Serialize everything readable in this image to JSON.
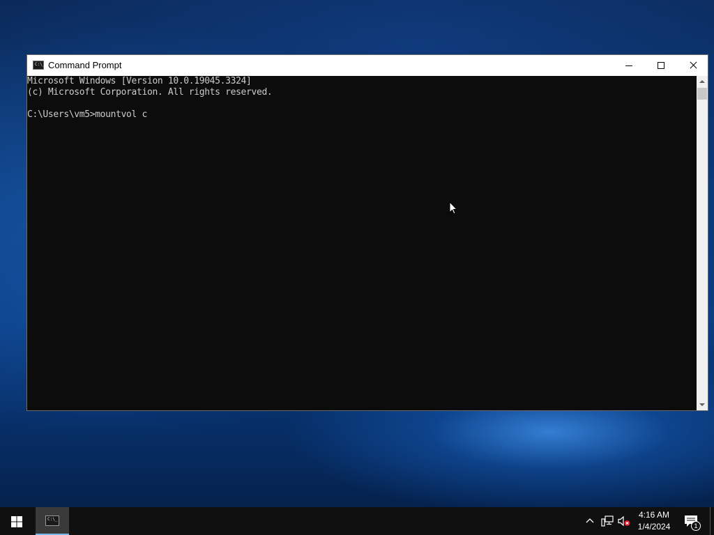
{
  "window": {
    "title": "Command Prompt",
    "icon": "cmd-icon",
    "icon_glyph": "C:\\_"
  },
  "console": {
    "lines": [
      "Microsoft Windows [Version 10.0.19045.3324]",
      "(c) Microsoft Corporation. All rights reserved.",
      "",
      "C:\\Users\\vm5>mountvol c"
    ]
  },
  "taskbar": {
    "start_icon": "windows-logo-icon",
    "apps": [
      {
        "name": "Command Prompt",
        "icon": "cmd-icon",
        "active": true
      }
    ],
    "tray": {
      "icons": [
        "chevron-up-icon",
        "network-icon",
        "volume-muted-icon"
      ]
    },
    "clock": {
      "time": "4:16 AM",
      "date": "1/4/2024"
    },
    "notifications": {
      "count": "1"
    }
  },
  "colors": {
    "console_bg": "#0c0c0c",
    "console_text": "#cccccc",
    "taskbar_bg": "#101010",
    "accent": "#76b9ed"
  }
}
